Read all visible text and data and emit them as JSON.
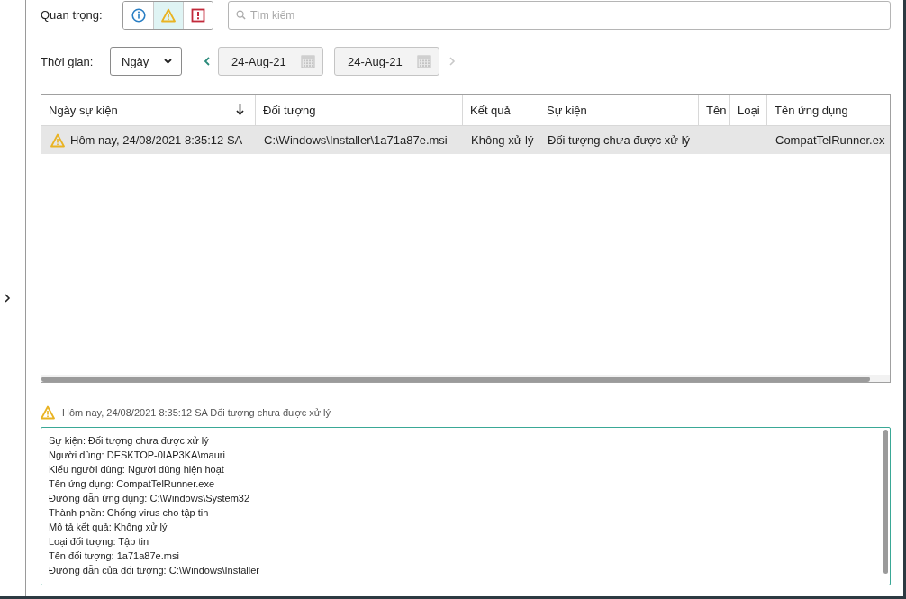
{
  "filters": {
    "label": "Quan trọng:",
    "items": [
      {
        "kind": "info",
        "selected": false
      },
      {
        "kind": "warning",
        "selected": true
      },
      {
        "kind": "error",
        "selected": false
      }
    ]
  },
  "search": {
    "placeholder": "Tìm kiếm"
  },
  "period": {
    "label": "Thời gian:",
    "value": "Ngày",
    "from": "24-Aug-21",
    "to": "24-Aug-21",
    "prev_disabled": false,
    "next_disabled": true
  },
  "table": {
    "columns": [
      {
        "label": "Ngày sự kiện",
        "sorted": true
      },
      {
        "label": "Đối tượng",
        "sorted": false
      },
      {
        "label": "Kết quả",
        "sorted": false
      },
      {
        "label": "Sự kiện",
        "sorted": false
      },
      {
        "label": "Tên",
        "sorted": false
      },
      {
        "label": "Loại",
        "sorted": false
      },
      {
        "label": "Tên ứng dụng",
        "sorted": false
      }
    ],
    "rows": [
      {
        "selected": true,
        "kind": "warning",
        "cells": [
          "Hôm nay, 24/08/2021 8:35:12 SA",
          "C:\\Windows\\Installer\\1a71a87e.msi",
          "Không xử lý",
          "Đối tượng chưa được xử lý",
          "",
          "",
          "CompatTelRunner.ex"
        ]
      }
    ]
  },
  "details": {
    "kind": "warning",
    "title": "Hôm nay, 24/08/2021 8:35:12 SA Đối tượng chưa được xử lý",
    "lines": [
      "Sự kiện: Đối tượng chưa được xử lý",
      "Người dùng: DESKTOP-0IAP3KA\\mauri",
      "Kiểu người dùng: Người dùng hiện hoạt",
      "Tên ứng dụng: CompatTelRunner.exe",
      "Đường dẫn ứng dụng: C:\\Windows\\System32",
      "Thành phần: Chống virus cho tập tin",
      "Mô tả kết quả: Không xử lý",
      "Loại đối tượng: Tập tin",
      "Tên đối tượng: 1a71a87e.msi",
      "Đường dẫn của đối tượng: C:\\Windows\\Installer"
    ]
  }
}
